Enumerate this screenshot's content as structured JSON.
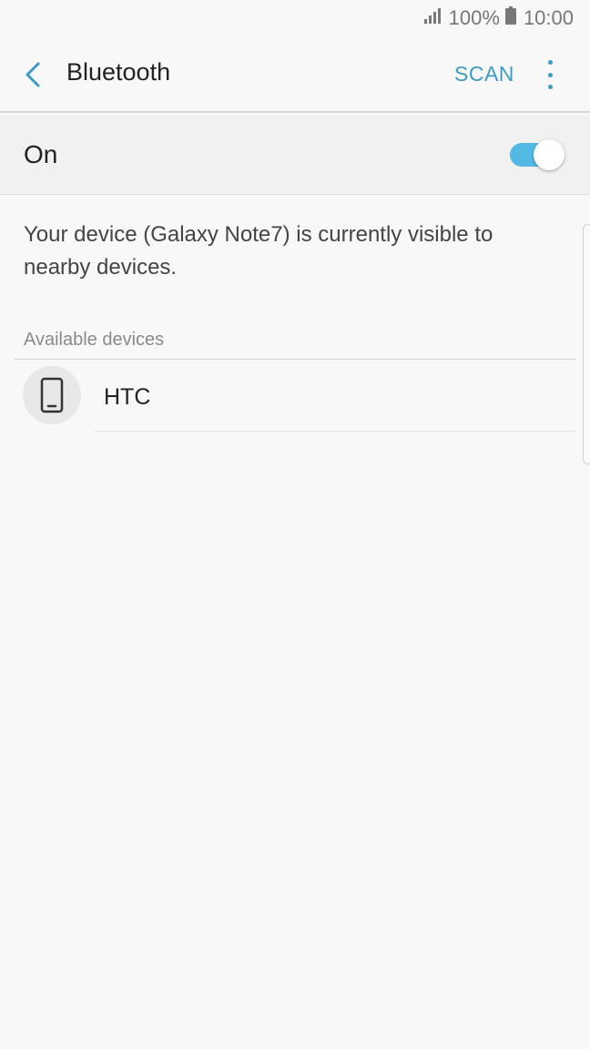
{
  "status_bar": {
    "signal_icon": "signal-icon",
    "battery_percent": "100%",
    "battery_icon": "battery-icon",
    "time": "10:00"
  },
  "toolbar": {
    "back_icon": "back-arrow-icon",
    "title": "Bluetooth",
    "scan_label": "SCAN",
    "more_icon": "more-vert-icon"
  },
  "bluetooth_switch": {
    "label": "On",
    "state": true,
    "accent_color": "#52b9e4"
  },
  "visibility_message": "Your device (Galaxy Note7) is currently visible to nearby devices.",
  "available_devices": {
    "header": "Available devices",
    "items": [
      {
        "name": "HTC",
        "icon": "smartphone-icon"
      }
    ]
  },
  "colors": {
    "accent": "#3e9ac4",
    "background": "#f8f8f8"
  }
}
